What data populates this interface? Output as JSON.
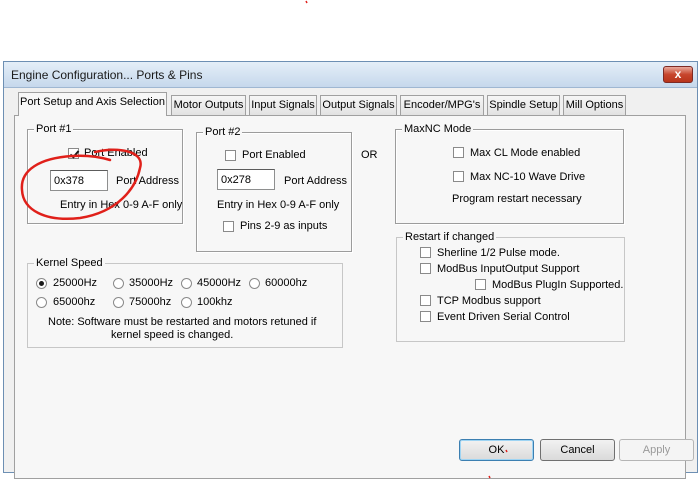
{
  "window": {
    "title": "Engine Configuration... Ports & Pins",
    "close_glyph": "x"
  },
  "tabs": [
    {
      "label": "Port Setup and Axis Selection",
      "active": true
    },
    {
      "label": "Motor Outputs"
    },
    {
      "label": "Input Signals"
    },
    {
      "label": "Output Signals"
    },
    {
      "label": "Encoder/MPG's"
    },
    {
      "label": "Spindle Setup"
    },
    {
      "label": "Mill Options"
    }
  ],
  "port1": {
    "title": "Port #1",
    "enabled_label": "Port Enabled",
    "enabled": true,
    "address_value": "0x378",
    "address_label": "Port Address",
    "hint": "Entry in Hex 0-9 A-F only"
  },
  "port2": {
    "title": "Port #2",
    "enabled_label": "Port Enabled",
    "enabled": false,
    "address_value": "0x278",
    "address_label": "Port Address",
    "hint": "Entry in Hex 0-9 A-F only",
    "pins_label": "Pins 2-9 as inputs",
    "pins_checked": false
  },
  "or_label": "OR",
  "maxnc": {
    "title": "MaxNC Mode",
    "max_cl_label": "Max CL Mode enabled",
    "max_nc10_label": "Max NC-10 Wave Drive",
    "note": "Program restart necessary"
  },
  "kernel": {
    "title": "Kernel Speed",
    "options": [
      "25000Hz",
      "35000Hz",
      "45000Hz",
      "60000hz",
      "65000hz",
      "75000hz",
      "100khz"
    ],
    "selected": "25000Hz",
    "note_line1": "Note: Software must be restarted and motors retuned if",
    "note_line2": "kernel speed is changed."
  },
  "restart": {
    "title": "Restart if changed",
    "sherline_label": "Sherline 1/2 Pulse mode.",
    "modbus_io_label": "ModBus InputOutput Support",
    "modbus_plugin_label": "ModBus PlugIn Supported.",
    "tcp_modbus_label": "TCP Modbus support",
    "event_serial_label": "Event Driven Serial Control"
  },
  "buttons": {
    "ok": "OK",
    "cancel": "Cancel",
    "apply": "Apply"
  },
  "colors": {
    "annotation_red": "#e0201a",
    "titlebar": "#c6d8ec",
    "close_button": "#c7452c"
  }
}
